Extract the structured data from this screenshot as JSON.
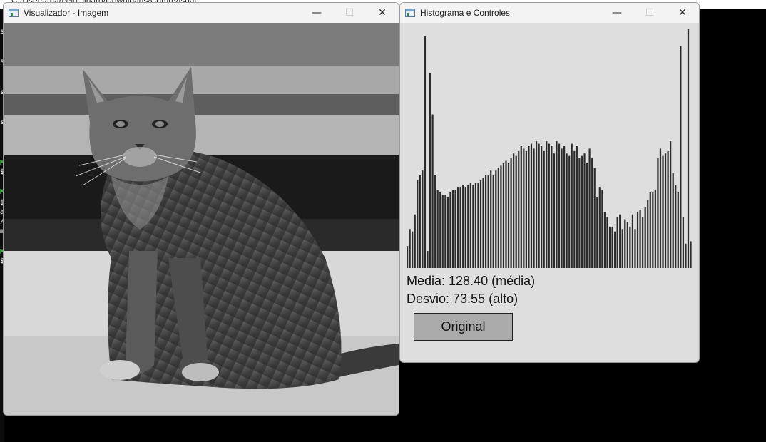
{
  "desktop": {
    "path_text": "C:/Users/marcelo_linaro/Downloads/CompVisual",
    "terminal_chars": [
      {
        "text": "s",
        "green": false
      },
      {
        "text": "s",
        "green": false
      },
      {
        "text": "s",
        "green": false
      },
      {
        "text": "s",
        "green": false
      },
      {
        "text": "M",
        "green": true
      },
      {
        "text": "$",
        "green": false
      },
      {
        "text": "M",
        "green": true
      },
      {
        "text": "$",
        "green": false
      },
      {
        "text": "a",
        "green": false
      },
      {
        "text": "/",
        "green": false
      },
      {
        "text": "m",
        "green": false
      },
      {
        "text": "M",
        "green": true
      },
      {
        "text": "$",
        "green": false
      }
    ]
  },
  "image_window": {
    "title": "Visualizador - Imagem",
    "icon": "window-app-icon",
    "image_description_icon": "cat-photo"
  },
  "histogram_window": {
    "title": "Histograma e Controles",
    "mean_label": "Media: 128.40 (média)",
    "dev_label": "Desvio: 73.55 (alto)",
    "original_button": "Original",
    "bar_color": "#2b2b2b",
    "background_color": "#dedede"
  },
  "window_controls": {
    "minimize": "—",
    "maximize": "☐",
    "close": "✕"
  },
  "chart_data": {
    "type": "bar",
    "title": "",
    "xlabel": "",
    "ylabel": "",
    "x_range": [
      0,
      255
    ],
    "grid": false,
    "values": [
      0.09,
      0.16,
      0.15,
      0.22,
      0.36,
      0.38,
      0.4,
      0.95,
      0.07,
      0.8,
      0.63,
      0.38,
      0.32,
      0.31,
      0.3,
      0.3,
      0.29,
      0.31,
      0.32,
      0.32,
      0.33,
      0.33,
      0.34,
      0.33,
      0.34,
      0.35,
      0.34,
      0.35,
      0.35,
      0.36,
      0.37,
      0.38,
      0.38,
      0.4,
      0.38,
      0.4,
      0.41,
      0.42,
      0.43,
      0.44,
      0.43,
      0.45,
      0.47,
      0.46,
      0.48,
      0.5,
      0.49,
      0.48,
      0.5,
      0.51,
      0.49,
      0.52,
      0.51,
      0.5,
      0.48,
      0.52,
      0.51,
      0.5,
      0.47,
      0.52,
      0.51,
      0.49,
      0.5,
      0.47,
      0.46,
      0.51,
      0.48,
      0.5,
      0.45,
      0.46,
      0.47,
      0.43,
      0.49,
      0.45,
      0.41,
      0.29,
      0.33,
      0.32,
      0.23,
      0.21,
      0.17,
      0.17,
      0.15,
      0.21,
      0.22,
      0.16,
      0.2,
      0.19,
      0.17,
      0.22,
      0.16,
      0.23,
      0.24,
      0.21,
      0.25,
      0.28,
      0.31,
      0.31,
      0.32,
      0.45,
      0.49,
      0.46,
      0.47,
      0.48,
      0.52,
      0.39,
      0.34,
      0.31,
      0.91,
      0.21,
      0.1,
      0.98,
      0.11
    ]
  }
}
